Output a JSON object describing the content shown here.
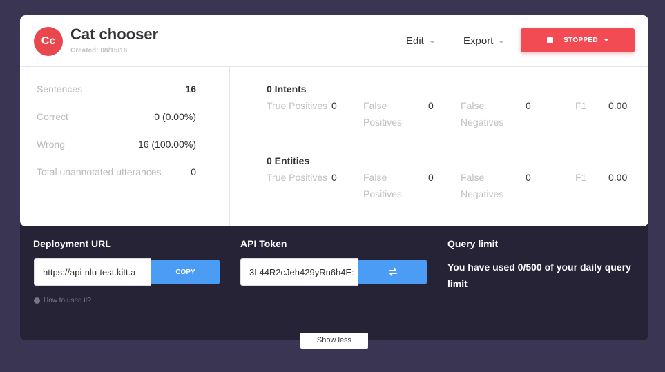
{
  "header": {
    "avatar_initials": "Cc",
    "title": "Cat chooser",
    "created": "Created: 08/15/16",
    "menu_edit": "Edit",
    "menu_export": "Export",
    "status_label": "STOPPED"
  },
  "stats": [
    {
      "label": "Sentences",
      "value": "16"
    },
    {
      "label": "Correct",
      "value": "0 (0.00%)"
    },
    {
      "label": "Wrong",
      "value": "16 (100.00%)"
    },
    {
      "label": "Total unannotated utterances",
      "value": "0"
    }
  ],
  "intents": {
    "title": "0 Intents",
    "tp_label": "True Positives",
    "tp_value": "0",
    "fp_label": "False Positives",
    "fp_value": "0",
    "fn_label": "False Negatives",
    "fn_value": "0",
    "f1_label": "F1",
    "f1_value": "0.00"
  },
  "entities": {
    "title": "0 Entities",
    "tp_label": "True Positives",
    "tp_value": "0",
    "fp_label": "False Positives",
    "fp_value": "0",
    "fn_label": "False Negatives",
    "fn_value": "0",
    "f1_label": "F1",
    "f1_value": "0.00"
  },
  "deployment": {
    "label": "Deployment URL",
    "url": "https://api-nlu-test.kitt.a",
    "copy_label": "COPY",
    "help": "How to used it?"
  },
  "api_token": {
    "label": "API Token",
    "value": "3L44R2cJeh429yRn6h4E:"
  },
  "query": {
    "label": "Query limit",
    "prefix": "You have used ",
    "usage": "0/500",
    "suffix": " of your daily query limit"
  },
  "show_less": "Show less",
  "colors": {
    "accent_red": "#f34b54",
    "accent_blue": "#4a9cf5",
    "background": "#3a3552",
    "panel": "#262336"
  }
}
